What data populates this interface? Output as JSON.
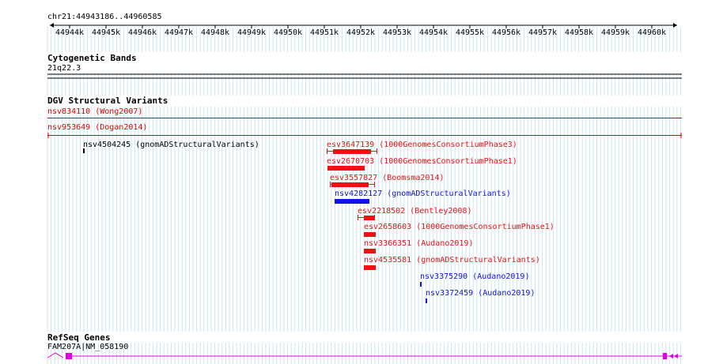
{
  "ruler": {
    "location": "chr21:44943186..44960585",
    "ticks": [
      "44944k",
      "44945k",
      "44946k",
      "44947k",
      "44948k",
      "44949k",
      "44950k",
      "44951k",
      "44952k",
      "44953k",
      "44954k",
      "44955k",
      "44956k",
      "44957k",
      "44958k",
      "44959k",
      "44960k"
    ]
  },
  "tracks": {
    "cytoband": {
      "title": "Cytogenetic Bands",
      "band": "21q22.3"
    },
    "dgv": {
      "title": "DGV Structural Variants",
      "features": [
        {
          "id": "nsv834110",
          "label": "nsv834110 (Wong2007)",
          "color": "#e00000"
        },
        {
          "id": "nsv953649",
          "label": "nsv953649 (Dogan2014)",
          "color": "#e00000"
        },
        {
          "id": "nsv4504245",
          "label": "nsv4504245 (gnomADStructuralVariants)",
          "color": "#000000"
        },
        {
          "id": "esv3647139",
          "label": "esv3647139 (1000GenomesConsortiumPhase3)",
          "color": "#ee1111"
        },
        {
          "id": "esv2670703",
          "label": "esv2670703 (1000GenomesConsortiumPhase1)",
          "color": "#ee1111"
        },
        {
          "id": "esv3557827",
          "label": "esv3557827 (Boomsma2014)",
          "color": "#ee1111"
        },
        {
          "id": "nsv4282127",
          "label": "nsv4282127 (gnomADStructuralVariants)",
          "color": "#1111ee"
        },
        {
          "id": "esv2218502",
          "label": "esv2218502 (Bentley2008)",
          "color": "#ee1111"
        },
        {
          "id": "esv2658603",
          "label": "esv2658603 (1000GenomesConsortiumPhase1)",
          "color": "#ee1111"
        },
        {
          "id": "nsv3366351",
          "label": "nsv3366351 (Audano2019)",
          "color": "#ee1111"
        },
        {
          "id": "nsv4535581",
          "label": "nsv4535581 (gnomADStructuralVariants)",
          "color": "#ee1111"
        },
        {
          "id": "nsv3375290",
          "label": "nsv3375290 (Audano2019)",
          "color": "#1111ee"
        },
        {
          "id": "nsv3372459",
          "label": "nsv3372459 (Audano2019)",
          "color": "#1111ee"
        }
      ]
    },
    "refseq": {
      "title": "RefSeq Genes",
      "gene": "FAM207A|NM_058190",
      "color": "#e000e0"
    }
  }
}
